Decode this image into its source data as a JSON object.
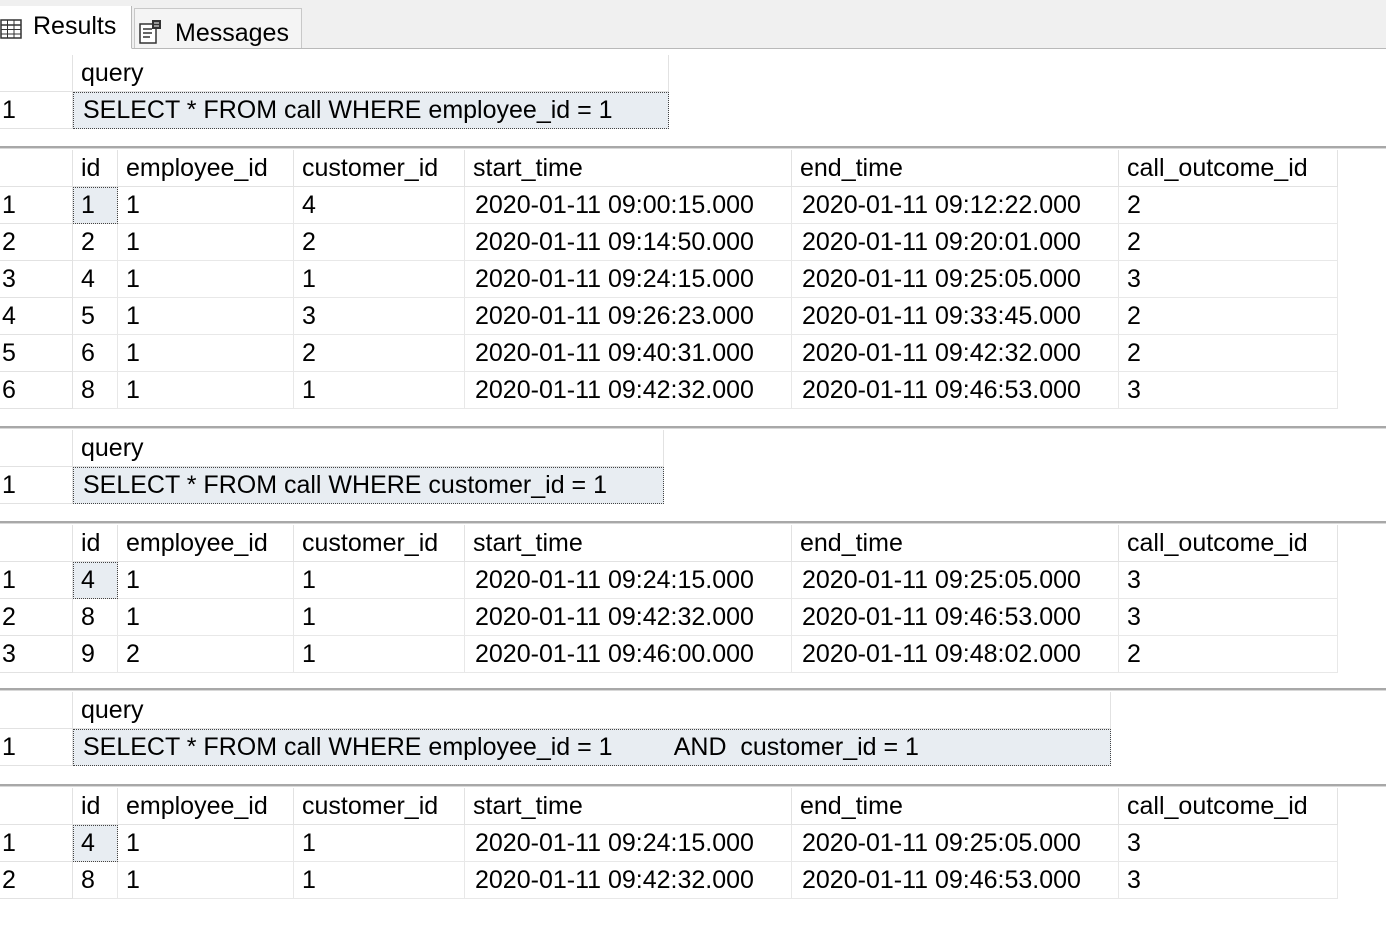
{
  "tabs": [
    {
      "label": "Results",
      "icon": "grid-icon"
    },
    {
      "label": "Messages",
      "icon": "messages-icon"
    }
  ],
  "grids": [
    {
      "type": "query",
      "header": "query",
      "rows": [
        [
          "1",
          "SELECT * FROM call WHERE employee_id = 1"
        ]
      ]
    },
    {
      "type": "table",
      "columns": [
        "id",
        "employee_id",
        "customer_id",
        "start_time",
        "end_time",
        "call_outcome_id"
      ],
      "rows": [
        {
          "n": "1",
          "cells": [
            "1",
            "1",
            "4",
            "2020-01-11 09:00:15.000",
            "2020-01-11 09:12:22.000",
            "2"
          ]
        },
        {
          "n": "2",
          "cells": [
            "2",
            "1",
            "2",
            "2020-01-11 09:14:50.000",
            "2020-01-11 09:20:01.000",
            "2"
          ]
        },
        {
          "n": "3",
          "cells": [
            "4",
            "1",
            "1",
            "2020-01-11 09:24:15.000",
            "2020-01-11 09:25:05.000",
            "3"
          ]
        },
        {
          "n": "4",
          "cells": [
            "5",
            "1",
            "3",
            "2020-01-11 09:26:23.000",
            "2020-01-11 09:33:45.000",
            "2"
          ]
        },
        {
          "n": "5",
          "cells": [
            "6",
            "1",
            "2",
            "2020-01-11 09:40:31.000",
            "2020-01-11 09:42:32.000",
            "2"
          ]
        },
        {
          "n": "6",
          "cells": [
            "8",
            "1",
            "1",
            "2020-01-11 09:42:32.000",
            "2020-01-11 09:46:53.000",
            "3"
          ]
        }
      ]
    },
    {
      "type": "query",
      "header": "query",
      "rows": [
        [
          "1",
          "SELECT * FROM call WHERE customer_id = 1"
        ]
      ]
    },
    {
      "type": "table",
      "columns": [
        "id",
        "employee_id",
        "customer_id",
        "start_time",
        "end_time",
        "call_outcome_id"
      ],
      "rows": [
        {
          "n": "1",
          "cells": [
            "4",
            "1",
            "1",
            "2020-01-11 09:24:15.000",
            "2020-01-11 09:25:05.000",
            "3"
          ]
        },
        {
          "n": "2",
          "cells": [
            "8",
            "1",
            "1",
            "2020-01-11 09:42:32.000",
            "2020-01-11 09:46:53.000",
            "3"
          ]
        },
        {
          "n": "3",
          "cells": [
            "9",
            "2",
            "1",
            "2020-01-11 09:46:00.000",
            "2020-01-11 09:48:02.000",
            "2"
          ]
        }
      ]
    },
    {
      "type": "query",
      "header": "query",
      "rows": [
        [
          "1",
          "SELECT * FROM call WHERE employee_id = 1         AND  customer_id = 1"
        ]
      ]
    },
    {
      "type": "table",
      "columns": [
        "id",
        "employee_id",
        "customer_id",
        "start_time",
        "end_time",
        "call_outcome_id"
      ],
      "rows": [
        {
          "n": "1",
          "cells": [
            "4",
            "1",
            "1",
            "2020-01-11 09:24:15.000",
            "2020-01-11 09:25:05.000",
            "3"
          ]
        },
        {
          "n": "2",
          "cells": [
            "8",
            "1",
            "1",
            "2020-01-11 09:42:32.000",
            "2020-01-11 09:46:53.000",
            "3"
          ]
        }
      ]
    }
  ],
  "colors": {
    "selected_cell": "#e8edf2",
    "grid_line": "#e2e2e2",
    "separator": "#a8a8a8",
    "tab_bar": "#f0f0f0"
  }
}
